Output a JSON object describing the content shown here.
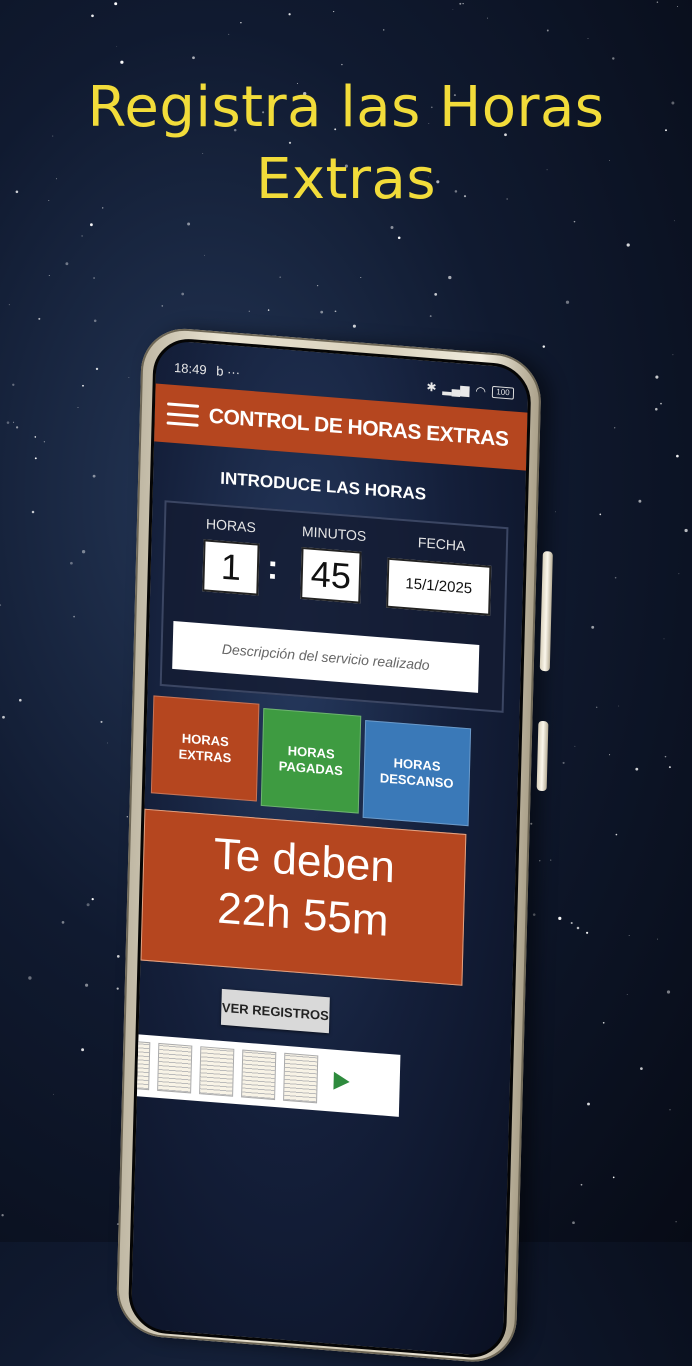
{
  "headline": {
    "line1": "Registra las Horas",
    "line2": "Extras"
  },
  "status": {
    "time": "18:49",
    "extra": "b ···",
    "battery": "100"
  },
  "app": {
    "title": "CONTROL DE HORAS EXTRAS"
  },
  "form": {
    "section_title": "INTRODUCE LAS HORAS",
    "hours_label": "HORAS",
    "hours_value": "1",
    "minutes_label": "MINUTOS",
    "minutes_value": "45",
    "date_label": "FECHA",
    "date_value": "15/1/2025",
    "description_placeholder": "Descripción del servicio realizado"
  },
  "buttons": {
    "extra_line1": "HORAS",
    "extra_line2": "EXTRAS",
    "paid_line1": "HORAS",
    "paid_line2": "PAGADAS",
    "rest_line1": "HORAS",
    "rest_line2": "DESCANSO"
  },
  "summary": {
    "line1": "Te deben",
    "line2": "22h 55m"
  },
  "records_button": "VER REGISTROS",
  "colors": {
    "accent": "#b5461f",
    "green": "#3e9b41",
    "blue": "#3a79b8",
    "headline": "#f2dc3a"
  }
}
